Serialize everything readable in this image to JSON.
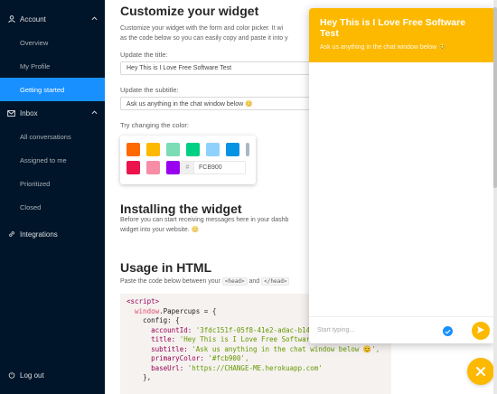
{
  "sidebar": {
    "account": {
      "label": "Account",
      "items": [
        "Overview",
        "My Profile",
        "Getting started"
      ],
      "active": "Getting started"
    },
    "inbox": {
      "label": "Inbox",
      "items": [
        "All conversations",
        "Assigned to me",
        "Prioritized",
        "Closed"
      ]
    },
    "integrations": "Integrations",
    "logout": "Log out"
  },
  "main": {
    "customize_title": "Customize your widget",
    "customize_desc_1": "Customize your widget with the form and color picker. It wi",
    "customize_desc_2": "as the code below so you can easily copy and paste it into y",
    "title_label": "Update the title:",
    "title_value": "Hey This is I Love Free Software Test",
    "subtitle_label": "Update the subtitle:",
    "subtitle_value": "Ask us anything in the chat window below 😊",
    "color_label": "Try changing the color:",
    "swatches": [
      "#ff6900",
      "#fcb900",
      "#7bdcb5",
      "#00d084",
      "#8ed1fc",
      "#0693e3",
      "#abb8c3",
      "#eb144c",
      "#f78da7",
      "#9900ef"
    ],
    "hex_hash": "#",
    "hex_value": "FCB900",
    "install_title": "Installing the widget",
    "install_desc_1": "Before you can start receiving messages here in your dashb",
    "install_desc_2": "widget into your website. 😊",
    "usage_title": "Usage in HTML",
    "usage_desc_pre": "Paste the code below between your",
    "usage_code_1": "<head>",
    "usage_desc_and": "and",
    "usage_code_2": "</head>"
  },
  "code": {
    "line1": "<script>",
    "line2_obj": "window",
    "line2_rest": ".Papercups = {",
    "line3": "config: {",
    "account_key": "accountId:",
    "account_val": "'3fdc151f-05f8-41e2-adac-b14",
    "title_key": "title:",
    "title_val": "'Hey This is I Love Free Software Test',",
    "subtitle_key": "subtitle:",
    "subtitle_val": "'Ask us anything in the chat window below 😊',",
    "color_key": "primaryColor:",
    "color_val": "'#fcb900',",
    "base_key": "baseUrl:",
    "base_val": "'https://CHANGE-ME.herokuapp.com'",
    "close": "},"
  },
  "chat": {
    "title": "Hey This is I Love Free Software Test",
    "subtitle": "Ask us anything in the chat window below 😊",
    "input_placeholder": "Start typing...",
    "primary_color": "#fcb900"
  }
}
